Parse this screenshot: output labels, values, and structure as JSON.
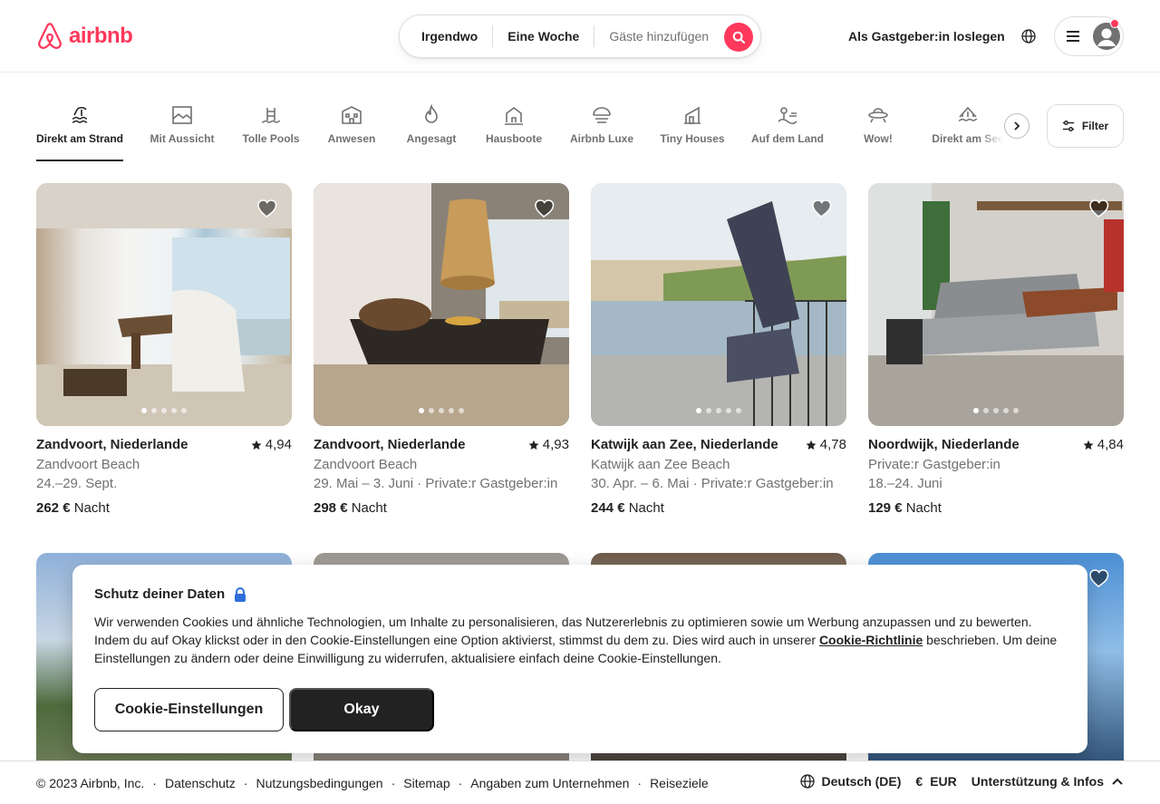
{
  "brand": {
    "name": "airbnb",
    "color": "#ff385c"
  },
  "search": {
    "where": "Irgendwo",
    "when": "Eine Woche",
    "guests_placeholder": "Gäste hinzufügen"
  },
  "header": {
    "host_link": "Als Gastgeber:in loslegen"
  },
  "categories": [
    {
      "label": "Direkt am Strand",
      "icon": "beachfront-icon",
      "active": true
    },
    {
      "label": "Mit Aussicht",
      "icon": "views-icon"
    },
    {
      "label": "Tolle Pools",
      "icon": "pool-icon"
    },
    {
      "label": "Anwesen",
      "icon": "mansion-icon"
    },
    {
      "label": "Angesagt",
      "icon": "trending-flame-icon"
    },
    {
      "label": "Hausboote",
      "icon": "houseboat-icon"
    },
    {
      "label": "Airbnb Luxe",
      "icon": "luxe-icon"
    },
    {
      "label": "Tiny Houses",
      "icon": "tiny-house-icon"
    },
    {
      "label": "Auf dem Land",
      "icon": "countryside-icon"
    },
    {
      "label": "Wow!",
      "icon": "omg-ufo-icon"
    },
    {
      "label": "Direkt am See",
      "icon": "lakefront-icon"
    }
  ],
  "filter_label": "Filter",
  "listings": [
    {
      "title": "Zandvoort, Niederlande",
      "rating": "4,94",
      "line1": "Zandvoort Beach",
      "line2": "24.–29. Sept.",
      "price": "262 €",
      "unit": "Nacht"
    },
    {
      "title": "Zandvoort, Niederlande",
      "rating": "4,93",
      "line1": "Zandvoort Beach",
      "line2": "29. Mai – 3. Juni · Private:r Gastgeber:in",
      "price": "298 €",
      "unit": "Nacht"
    },
    {
      "title": "Katwijk aan Zee, Niederlande",
      "rating": "4,78",
      "line1": "Katwijk aan Zee Beach",
      "line2": "30. Apr. – 6. Mai · Private:r Gastgeber:in",
      "price": "244 €",
      "unit": "Nacht"
    },
    {
      "title": "Noordwijk, Niederlande",
      "rating": "4,84",
      "line1": "Private:r Gastgeber:in",
      "line2": "18.–24. Juni",
      "price": "129 €",
      "unit": "Nacht"
    }
  ],
  "cookie": {
    "title": "Schutz deiner Daten",
    "text_before": "Wir verwenden Cookies und ähnliche Technologien, um Inhalte zu personalisieren, das Nutzererlebnis zu optimieren sowie um Werbung anzupassen und zu bewerten. Indem du auf Okay klickst oder in den Cookie-Einstellungen eine Option aktivierst, stimmst du dem zu. Dies wird auch in unserer ",
    "link": "Cookie-Richtlinie",
    "text_after": " beschrieben. Um deine Einstellungen zu ändern oder deine Einwilligung zu widerrufen, aktualisiere einfach deine Cookie-Einstellungen.",
    "settings_button": "Cookie-Einstellungen",
    "ok_button": "Okay"
  },
  "footer": {
    "copyright": "© 2023 Airbnb, Inc.",
    "links": [
      "Datenschutz",
      "Nutzungsbedingungen",
      "Sitemap",
      "Angaben zum Unternehmen",
      "Reiseziele"
    ],
    "language": "Deutsch (DE)",
    "currency_symbol": "€",
    "currency": "EUR",
    "support": "Unterstützung & Infos"
  }
}
